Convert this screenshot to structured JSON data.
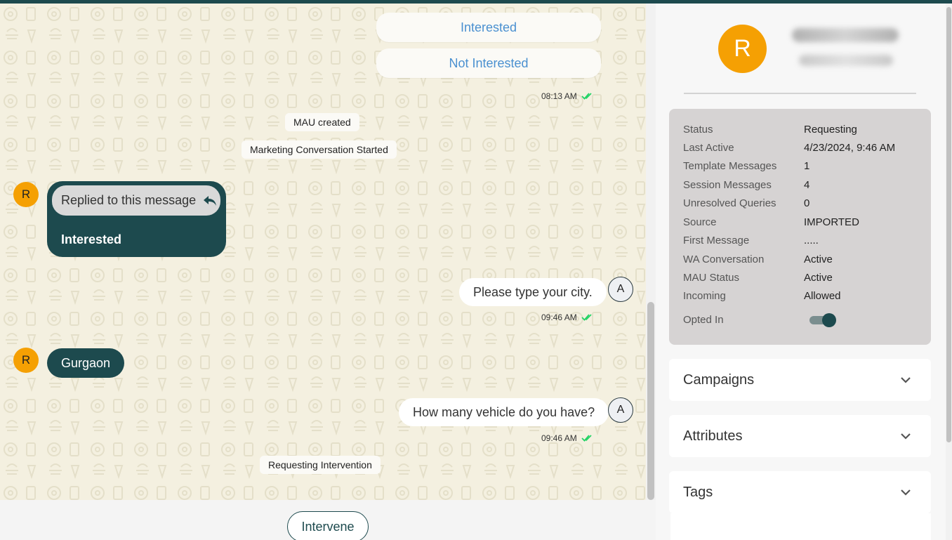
{
  "chat": {
    "quick_replies": [
      "Interested",
      "Not Interested"
    ],
    "timestamps": [
      "08:13 AM",
      "09:46 AM",
      "09:46 AM"
    ],
    "system_messages": [
      "MAU created",
      "Marketing Conversation Started",
      "Requesting Intervention"
    ],
    "incoming_avatar": "R",
    "agent_avatar": "A",
    "reply_label": "Replied to this message",
    "reply_text": "Interested",
    "incoming_message": "Gurgaon",
    "outgoing_messages": [
      "Please type your city.",
      "How many vehicle do you have?"
    ]
  },
  "bottom": {
    "intervene_label": "Intervene"
  },
  "contact": {
    "avatar_letter": "R"
  },
  "info": {
    "rows": [
      {
        "label": "Status",
        "value": "Requesting"
      },
      {
        "label": "Last Active",
        "value": "4/23/2024, 9:46 AM"
      },
      {
        "label": "Template Messages",
        "value": "1"
      },
      {
        "label": "Session Messages",
        "value": "4"
      },
      {
        "label": "Unresolved Queries",
        "value": "0"
      },
      {
        "label": "Source",
        "value": "IMPORTED"
      },
      {
        "label": "First Message",
        "value": "....."
      },
      {
        "label": "WA Conversation",
        "value": "Active"
      },
      {
        "label": "MAU Status",
        "value": "Active"
      },
      {
        "label": "Incoming",
        "value": "Allowed"
      }
    ],
    "opted_in_label": "Opted In",
    "opted_in": true
  },
  "accordions": [
    "Campaigns",
    "Attributes",
    "Tags"
  ],
  "colors": {
    "brand": "#1d4a4e",
    "avatar": "#f5a003",
    "link": "#4a90d0",
    "tick": "#25d366"
  }
}
